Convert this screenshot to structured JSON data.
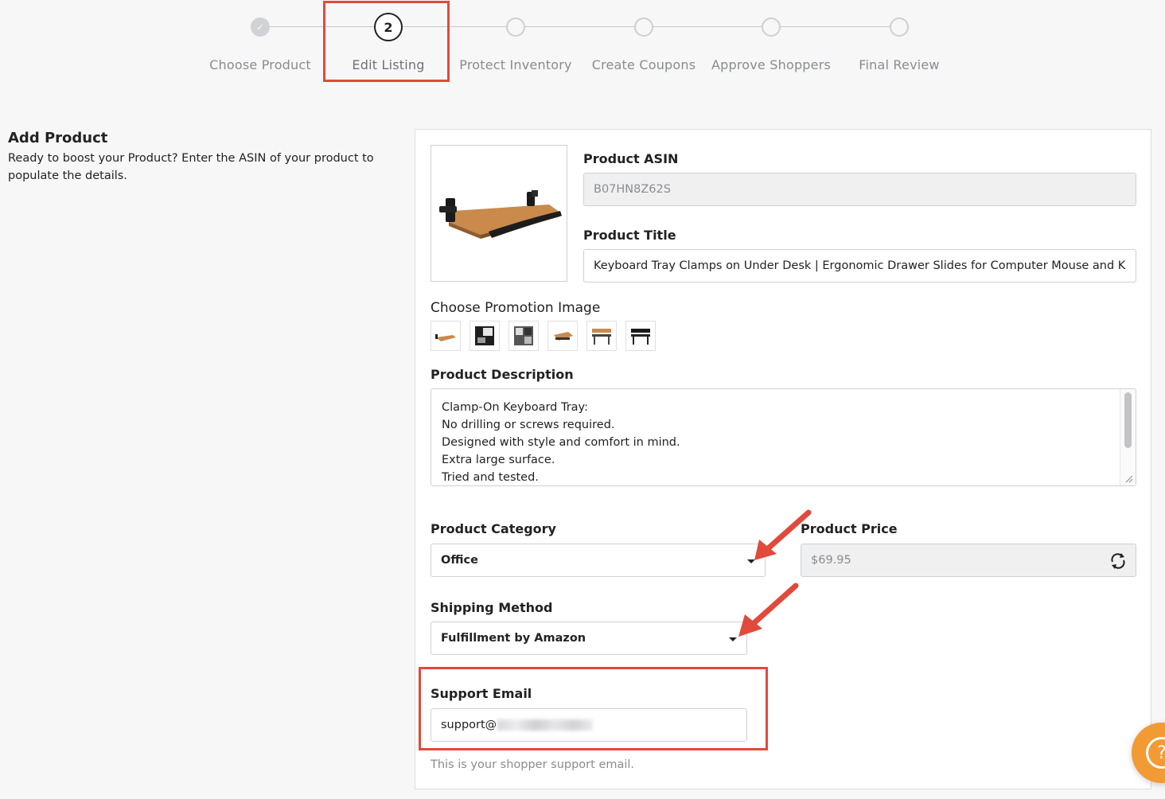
{
  "stepper": {
    "steps": [
      {
        "label": "Choose Product",
        "state": "done",
        "marker": "✓"
      },
      {
        "label": "Edit Listing",
        "state": "active",
        "marker": "2"
      },
      {
        "label": "Protect Inventory",
        "state": "pending",
        "marker": ""
      },
      {
        "label": "Create Coupons",
        "state": "pending",
        "marker": ""
      },
      {
        "label": "Approve Shoppers",
        "state": "pending",
        "marker": ""
      },
      {
        "label": "Final Review",
        "state": "pending",
        "marker": ""
      }
    ]
  },
  "intro": {
    "title": "Add Product",
    "description": "Ready to boost your Product? Enter the ASIN of your product to populate the details."
  },
  "form": {
    "asin_label": "Product ASIN",
    "asin_value": "B07HN8Z62S",
    "title_label": "Product Title",
    "title_value": "Keyboard Tray Clamps on Under Desk | Ergonomic Drawer Slides for Computer Mouse and K",
    "promo_image_label": "Choose Promotion Image",
    "description_label": "Product Description",
    "description_lines": [
      "Clamp-On Keyboard Tray:",
      "No drilling or screws required.",
      "Designed with style and comfort in mind.",
      "Extra large surface.",
      "Tried and tested."
    ],
    "category_label": "Product Category",
    "category_value": "Office",
    "price_label": "Product Price",
    "price_value": "$69.95",
    "shipping_label": "Shipping Method",
    "shipping_value": "Fulfillment by Amazon",
    "email_label": "Support Email",
    "email_value": "support@",
    "email_help": "This is your shopper support email."
  },
  "help_bubble": {
    "label": "?"
  },
  "colors": {
    "annotation_red": "#e14a3b",
    "help_orange": "#f29a34"
  }
}
